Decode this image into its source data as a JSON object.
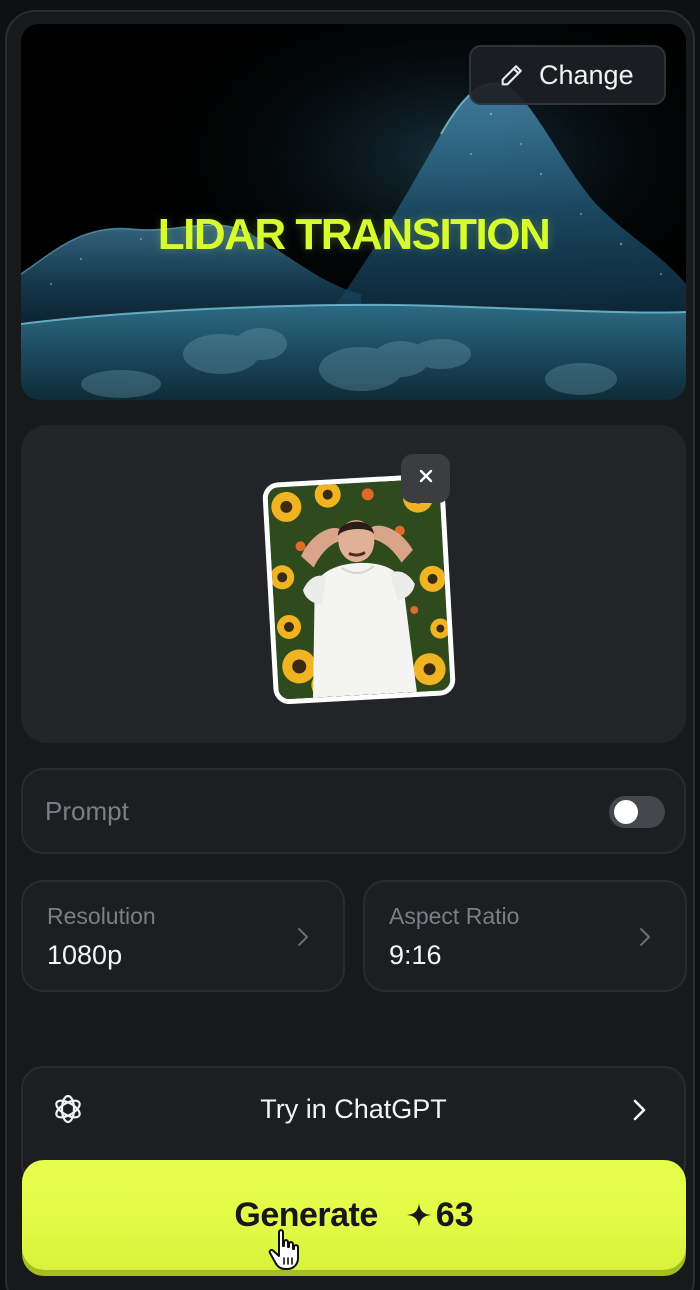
{
  "hero": {
    "title": "LIDAR TRANSITION",
    "change_label": "Change",
    "accent_color": "#d6fb2f"
  },
  "upload": {
    "remove_icon": "close-icon"
  },
  "prompt": {
    "label": "Prompt",
    "enabled": false
  },
  "settings": {
    "resolution": {
      "label": "Resolution",
      "value": "1080p"
    },
    "aspect_ratio": {
      "label": "Aspect Ratio",
      "value": "9:16"
    }
  },
  "chatgpt": {
    "label": "Try in ChatGPT",
    "icon": "openai-logo-icon"
  },
  "generate": {
    "label": "Generate",
    "credits": "63",
    "color": "#e4fc48"
  }
}
